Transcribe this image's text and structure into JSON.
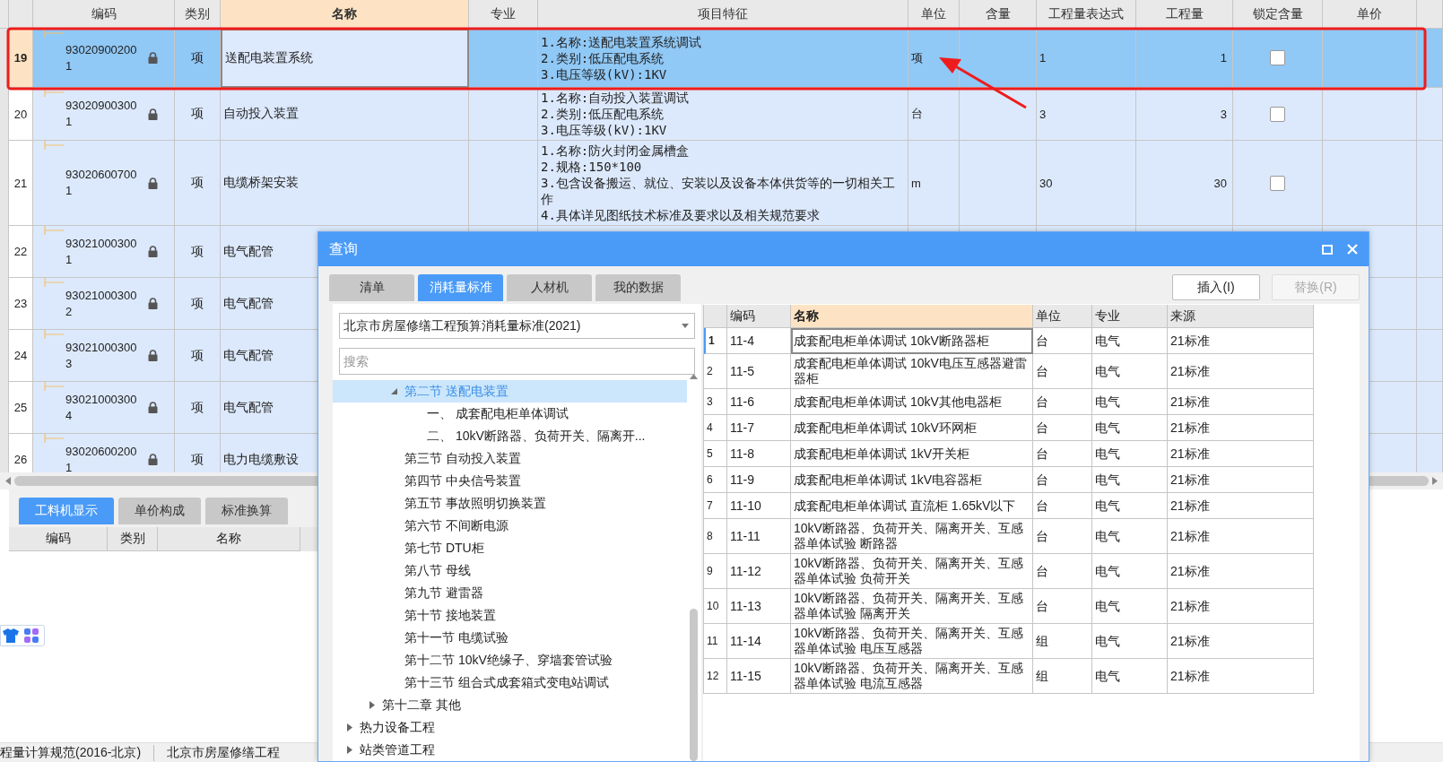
{
  "main_table": {
    "columns": [
      {
        "label": "编码",
        "highlighted": false
      },
      {
        "label": "类别",
        "highlighted": false
      },
      {
        "label": "名称",
        "highlighted": true
      },
      {
        "label": "专业",
        "highlighted": false
      },
      {
        "label": "项目特征",
        "highlighted": false
      },
      {
        "label": "单位",
        "highlighted": false
      },
      {
        "label": "含量",
        "highlighted": false
      },
      {
        "label": "工程量表达式",
        "highlighted": false
      },
      {
        "label": "工程量",
        "highlighted": false
      },
      {
        "label": "锁定含量",
        "highlighted": false
      },
      {
        "label": "单价",
        "highlighted": false
      }
    ],
    "rows": [
      {
        "num": "19",
        "code": "930209002001",
        "type": "项",
        "name": "送配电装置系统",
        "features": "1.名称:送配电装置系统调试\n2.类别:低压配电系统\n3.电压等级(kV):1KV",
        "unit": "项",
        "expr": "1",
        "qty": "1",
        "checked": false,
        "selected": true
      },
      {
        "num": "20",
        "code": "930209003001",
        "type": "项",
        "name": "自动投入装置",
        "features": "1.名称:自动投入装置调试\n2.类别:低压配电系统\n3.电压等级(kV):1KV",
        "unit": "台",
        "expr": "3",
        "qty": "3",
        "checked": false,
        "selected": false
      },
      {
        "num": "21",
        "code": "930206007001",
        "type": "项",
        "name": "电缆桥架安装",
        "features": "1.名称:防火封闭金属槽盒\n2.规格:150*100\n3.包含设备搬运、就位、安装以及设备本体供货等的一切相关工作\n4.具体详见图纸技术标准及要求以及相关规范要求",
        "unit": "m",
        "expr": "30",
        "qty": "30",
        "checked": false,
        "selected": false
      },
      {
        "num": "22",
        "code": "930210003001",
        "type": "项",
        "name": "电气配管",
        "selected": false
      },
      {
        "num": "23",
        "code": "930210003002",
        "type": "项",
        "name": "电气配管",
        "selected": false
      },
      {
        "num": "24",
        "code": "930210003003",
        "type": "项",
        "name": "电气配管",
        "selected": false
      },
      {
        "num": "25",
        "code": "930210003004",
        "type": "项",
        "name": "电气配管",
        "selected": false
      },
      {
        "num": "26",
        "code": "930206002001",
        "type": "项",
        "name": "电力电缆敷设",
        "selected": false
      }
    ]
  },
  "bottom_panel": {
    "tabs": [
      {
        "label": "工料机显示",
        "selected": true
      },
      {
        "label": "单价构成",
        "selected": false
      },
      {
        "label": "标准换算",
        "selected": false
      }
    ],
    "columns": [
      "编码",
      "类别",
      "名称"
    ]
  },
  "status_bar": [
    "程量计算规范(2016-北京)",
    "北京市房屋修缮工程"
  ],
  "dialog": {
    "title": "查询",
    "tabs": [
      {
        "label": "清单",
        "selected": false
      },
      {
        "label": "消耗量标准",
        "selected": true
      },
      {
        "label": "人材机",
        "selected": false
      },
      {
        "label": "我的数据",
        "selected": false
      }
    ],
    "buttons": [
      {
        "label": "插入(I)",
        "disabled": false
      },
      {
        "label": "替换(R)",
        "disabled": true
      }
    ],
    "library_select": {
      "value": "北京市房屋修缮工程预算消耗量标准(2021)"
    },
    "search": {
      "placeholder": "搜索"
    },
    "tree": [
      {
        "children": [
          {
            "children": [
              {
                "label": "第二节 送配电装置",
                "expanded": true,
                "selected": true,
                "children": [
                  {
                    "label": "一、 成套配电柜单体调试",
                    "selected": false
                  },
                  {
                    "label": "二、 10kV断路器、负荷开关、隔离开...",
                    "selected": false
                  }
                ]
              },
              {
                "label": "第三节 自动投入装置",
                "selected": false
              },
              {
                "label": "第四节 中央信号装置",
                "selected": false
              },
              {
                "label": "第五节 事故照明切换装置",
                "selected": false
              },
              {
                "label": "第六节 不间断电源",
                "selected": false
              },
              {
                "label": "第七节 DTU柜",
                "selected": false
              },
              {
                "label": "第八节 母线",
                "selected": false
              },
              {
                "label": "第九节 避雷器",
                "selected": false
              },
              {
                "label": "第十节 接地装置",
                "selected": false
              },
              {
                "label": "第十一节 电缆试验",
                "selected": false
              },
              {
                "label": "第十二节 10kV绝缘子、穿墙套管试验",
                "selected": false
              },
              {
                "label": "第十三节 组合式成套箱式变电站调试",
                "selected": false
              }
            ]
          },
          {
            "label": "第十二章 其他",
            "expanded": false,
            "selected": false
          }
        ]
      },
      {
        "label": "热力设备工程",
        "expanded": false,
        "selected": false
      },
      {
        "label": "站类管道工程",
        "expanded": false,
        "selected": false
      }
    ],
    "table": {
      "columns": [
        {
          "label": "编码",
          "highlighted": false
        },
        {
          "label": "名称",
          "highlighted": true
        },
        {
          "label": "单位",
          "highlighted": false
        },
        {
          "label": "专业",
          "highlighted": false
        },
        {
          "label": "来源",
          "highlighted": false
        }
      ],
      "rows": [
        {
          "num": "1",
          "code": "11-4",
          "name": "成套配电柜单体调试 10kV断路器柜",
          "unit": "台",
          "major": "电气",
          "source": "21标准",
          "selected": true
        },
        {
          "num": "2",
          "code": "11-5",
          "name": "成套配电柜单体调试 10kV电压互感器避雷器柜",
          "unit": "台",
          "major": "电气",
          "source": "21标准",
          "selected": false
        },
        {
          "num": "3",
          "code": "11-6",
          "name": "成套配电柜单体调试 10kV其他电器柜",
          "unit": "台",
          "major": "电气",
          "source": "21标准",
          "selected": false
        },
        {
          "num": "4",
          "code": "11-7",
          "name": "成套配电柜单体调试 10kV环网柜",
          "unit": "台",
          "major": "电气",
          "source": "21标准",
          "selected": false
        },
        {
          "num": "5",
          "code": "11-8",
          "name": "成套配电柜单体调试 1kV开关柜",
          "unit": "台",
          "major": "电气",
          "source": "21标准",
          "selected": false
        },
        {
          "num": "6",
          "code": "11-9",
          "name": "成套配电柜单体调试 1kV电容器柜",
          "unit": "台",
          "major": "电气",
          "source": "21标准",
          "selected": false
        },
        {
          "num": "7",
          "code": "11-10",
          "name": "成套配电柜单体调试 直流柜 1.65kV以下",
          "unit": "台",
          "major": "电气",
          "source": "21标准",
          "selected": false
        },
        {
          "num": "8",
          "code": "11-11",
          "name": "10kV断路器、负荷开关、隔离开关、互感器单体试验 断路器",
          "unit": "台",
          "major": "电气",
          "source": "21标准",
          "selected": false
        },
        {
          "num": "9",
          "code": "11-12",
          "name": "10kV断路器、负荷开关、隔离开关、互感器单体试验 负荷开关",
          "unit": "台",
          "major": "电气",
          "source": "21标准",
          "selected": false
        },
        {
          "num": "10",
          "code": "11-13",
          "name": "10kV断路器、负荷开关、隔离开关、互感器单体试验 隔离开关",
          "unit": "台",
          "major": "电气",
          "source": "21标准",
          "selected": false
        },
        {
          "num": "11",
          "code": "11-14",
          "name": "10kV断路器、负荷开关、隔离开关、互感器单体试验 电压互感器",
          "unit": "组",
          "major": "电气",
          "source": "21标准",
          "selected": false
        },
        {
          "num": "12",
          "code": "11-15",
          "name": "10kV断路器、负荷开关、隔离开关、互感器单体试验 电流互感器",
          "unit": "组",
          "major": "电气",
          "source": "21标准",
          "selected": false
        }
      ]
    }
  }
}
